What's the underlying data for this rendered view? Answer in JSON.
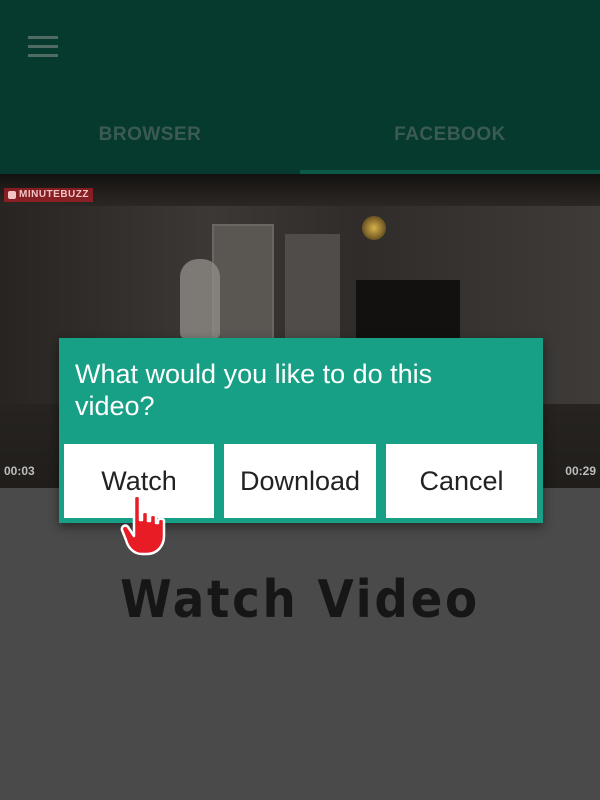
{
  "app_bar": {
    "menu_icon": "hamburger-menu-icon",
    "tabs": [
      {
        "label": "BROWSER",
        "selected": false
      },
      {
        "label": "FACEBOOK",
        "selected": true
      }
    ],
    "colors": {
      "background": "#063a2e",
      "tab_text": "#3a5a52",
      "indicator": "#0b5a47"
    }
  },
  "video": {
    "watermark": "MINUTEBUZZ",
    "elapsed": "00:03",
    "duration": "00:29"
  },
  "dialog": {
    "title": "What would you like to do this video?",
    "buttons": {
      "watch": "Watch",
      "download": "Download",
      "cancel": "Cancel"
    },
    "color": "#17a085"
  },
  "pointer_icon": "pointing-hand-cursor-icon",
  "headline": "Watch Video"
}
